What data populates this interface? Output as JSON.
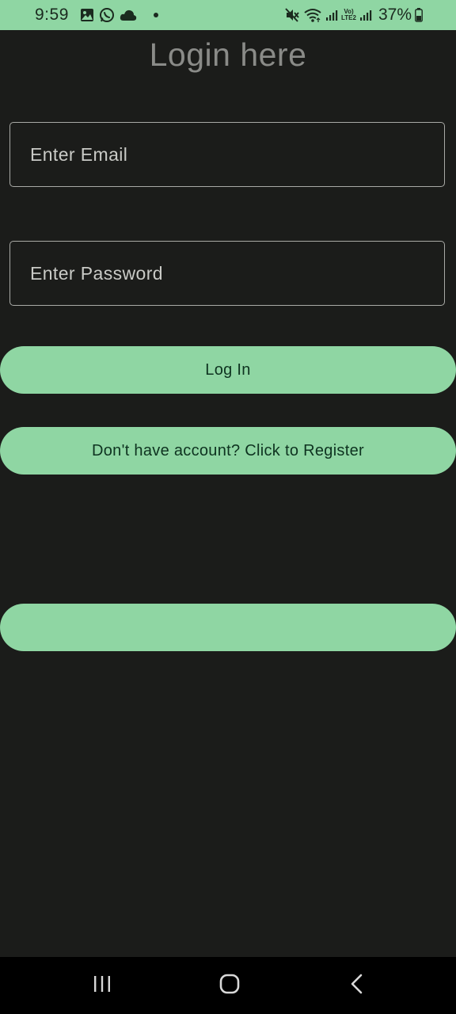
{
  "status_bar": {
    "time": "9:59",
    "battery_percent": "37%",
    "lte_label_top": "Vo)",
    "lte_label_bottom": "LTE2",
    "background_color": "#8fd6a3",
    "left_icons": [
      "gallery-icon",
      "whatsapp-icon",
      "cloud-icon",
      "notification-dot-icon"
    ],
    "right_icons": [
      "mute-icon",
      "wifi-icon",
      "signal-icon",
      "volte-icon",
      "signal-icon",
      "battery-icon"
    ]
  },
  "page": {
    "title": "Login here",
    "background_color": "#1b1c1a"
  },
  "form": {
    "email_placeholder": "Enter Email",
    "password_placeholder": "Enter Password"
  },
  "buttons": {
    "login_label": "Log In",
    "register_label": "Don't have account? Click to Register",
    "blank_label": "",
    "accent_color": "#8fd6a3"
  },
  "nav_bar": {
    "icons": [
      "recents-icon",
      "home-icon",
      "back-icon"
    ]
  }
}
